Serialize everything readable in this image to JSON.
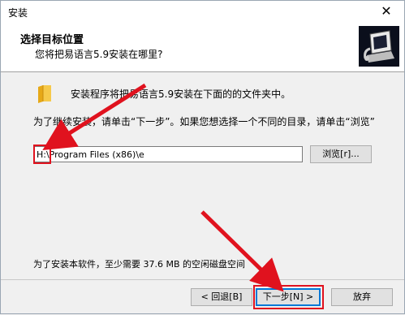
{
  "window": {
    "title": "安装",
    "close_glyph": "✕"
  },
  "header": {
    "title": "选择目标位置",
    "subtitle": "您将把易语言5.9安装在哪里?"
  },
  "content": {
    "intro": "安装程序将把易语言5.9安装在下面的的文件夹中。",
    "instruction": "为了继续安装，请单击“下一步”。如果您想选择一个不同的目录，请单击“浏览”",
    "path_value": "H:\\Program Files (x86)\\e",
    "browse_label": "浏览[r]...",
    "space_required": "为了安装本软件，至少需要 37.6 MB 的空闲磁盘空间"
  },
  "buttons": {
    "back": "< 回退[B]",
    "next": "下一步[N] >",
    "cancel": "放弃"
  },
  "annotations": {
    "color": "#e0121e"
  },
  "icons": [
    "folder-icon",
    "installer-logo-icon",
    "close-icon"
  ]
}
